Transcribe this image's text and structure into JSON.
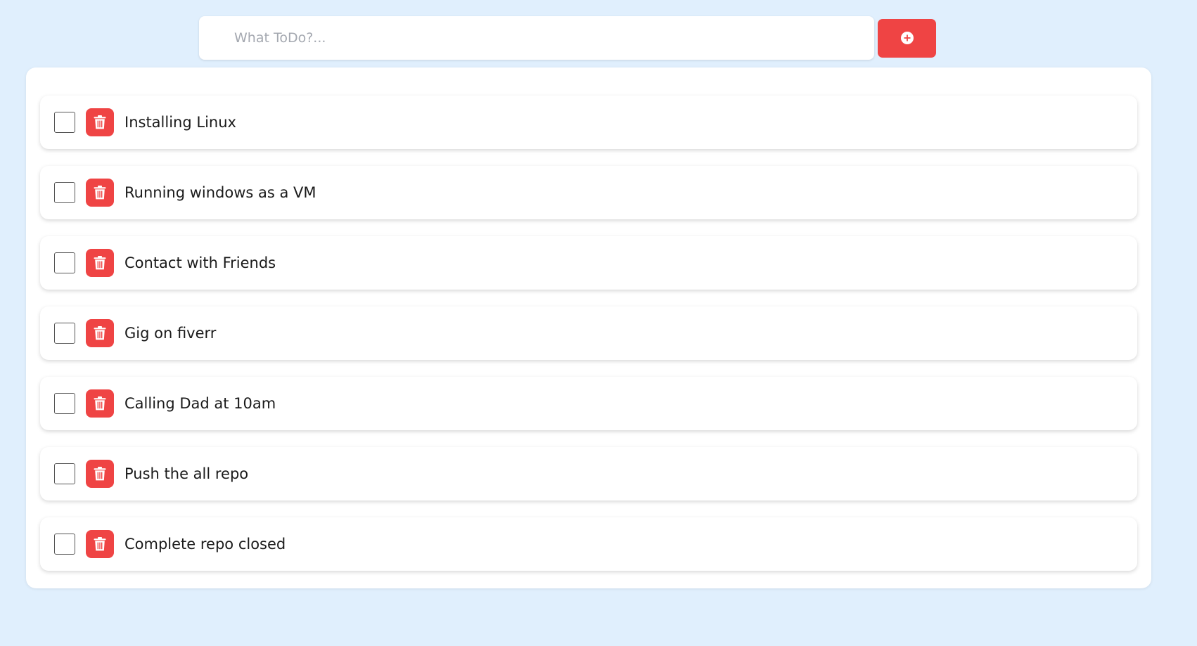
{
  "input": {
    "placeholder": "What ToDo?...",
    "value": ""
  },
  "add_button": {
    "icon": "plus-circle-icon"
  },
  "todos": [
    {
      "text": "Installing Linux",
      "checked": false
    },
    {
      "text": "Running windows as a VM",
      "checked": false
    },
    {
      "text": "Contact with Friends",
      "checked": false
    },
    {
      "text": "Gig on fiverr",
      "checked": false
    },
    {
      "text": "Calling Dad at 10am",
      "checked": false
    },
    {
      "text": "Push the all repo",
      "checked": false
    },
    {
      "text": "Complete repo closed",
      "checked": false
    }
  ],
  "icons": {
    "delete": "trash-icon"
  },
  "colors": {
    "background": "#e0effd",
    "accent": "#ef4444",
    "card": "#ffffff"
  }
}
